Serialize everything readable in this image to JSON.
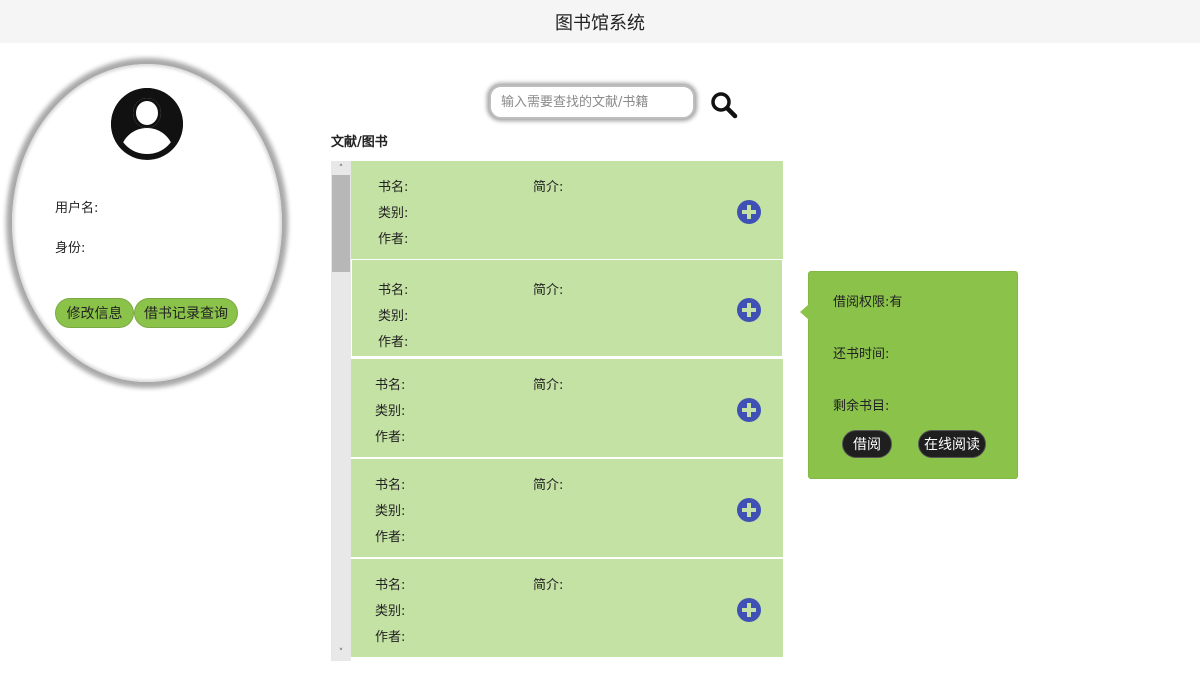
{
  "header": {
    "title": "图书馆系统"
  },
  "profile": {
    "avatar_icon": "user-circle-icon",
    "username_label": "用户名:",
    "identity_label": "身份:",
    "edit_button": "修改信息",
    "history_button": "借书记录查询"
  },
  "search": {
    "placeholder": "输入需要查找的文献/书籍",
    "value": "",
    "icon": "search-icon"
  },
  "section": {
    "title": "文献/图书"
  },
  "scrollbar": {
    "up_arrow": "˄",
    "down_arrow": "˅"
  },
  "books": [
    {
      "name_label": "书名:",
      "category_label": "类别:",
      "author_label": "作者:",
      "intro_label": "简介:"
    },
    {
      "name_label": "书名:",
      "category_label": "类别:",
      "author_label": "作者:",
      "intro_label": "简介:"
    },
    {
      "name_label": "书名:",
      "category_label": "类别:",
      "author_label": "作者:",
      "intro_label": "简介:"
    },
    {
      "name_label": "书名:",
      "category_label": "类别:",
      "author_label": "作者:",
      "intro_label": "简介:"
    },
    {
      "name_label": "书名:",
      "category_label": "类别:",
      "author_label": "作者:",
      "intro_label": "简介:"
    }
  ],
  "popover": {
    "permission_label": "借阅权限:有",
    "return_time_label": "还书时间:",
    "remaining_label": "剩余书目:",
    "borrow_button": "借阅",
    "read_online_button": "在线阅读"
  },
  "colors": {
    "card_green": "#c5e2a5",
    "accent_green": "#8bc34a",
    "add_icon_blue": "#3f51b5",
    "dark_button": "#1f1f1f"
  }
}
